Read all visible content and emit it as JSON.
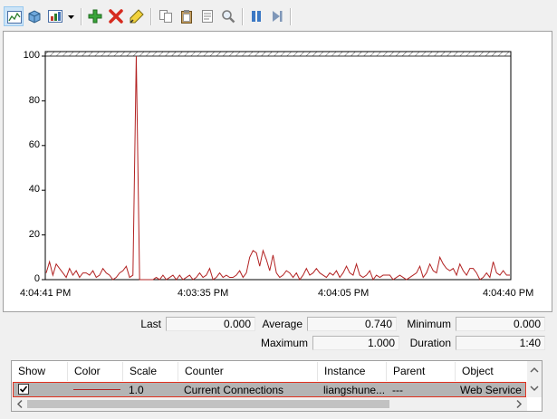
{
  "toolbar": {
    "icons": [
      "change-graph-type-icon",
      "view-current-activity-icon",
      "change-view-icon",
      "dropdown-icon",
      "add-counter-icon",
      "delete-counter-icon",
      "highlight-icon",
      "copy-properties-icon",
      "paste-counter-list-icon",
      "properties-icon",
      "zoom-icon",
      "freeze-display-icon",
      "update-data-icon"
    ]
  },
  "chart_data": {
    "type": "line",
    "ylim": [
      0,
      100
    ],
    "yticks": [
      "100",
      "80",
      "60",
      "40",
      "20",
      "0"
    ],
    "xtick_labels": [
      "4:04:41 PM",
      "4:03:35 PM",
      "4:04:05 PM",
      "4:04:40 PM"
    ],
    "grid": false,
    "series": [
      {
        "color": "#b22222",
        "y": [
          3,
          8,
          2,
          7,
          5,
          3,
          1,
          5,
          2,
          4,
          1,
          3,
          3,
          2,
          4,
          1,
          2,
          5,
          3,
          2,
          0,
          1,
          3,
          4,
          6,
          1,
          2,
          100,
          0,
          0,
          0,
          0,
          0,
          1,
          0,
          2,
          0,
          1,
          2,
          0,
          2,
          0,
          1,
          2,
          0,
          1,
          3,
          1,
          2,
          5,
          0,
          1,
          3,
          1,
          2,
          1,
          1,
          2,
          4,
          1,
          3,
          10,
          13,
          12,
          6,
          13,
          9,
          4,
          11,
          3,
          1,
          2,
          4,
          3,
          1,
          3,
          0,
          2,
          5,
          2,
          3,
          5,
          3,
          2,
          1,
          3,
          2,
          4,
          1,
          3,
          6,
          3,
          2,
          7,
          2,
          1,
          2,
          4,
          0,
          2,
          1,
          2,
          2,
          2,
          0,
          1,
          2,
          1,
          0,
          1,
          2,
          3,
          6,
          1,
          3,
          7,
          4,
          3,
          10,
          7,
          5,
          4,
          5,
          2,
          7,
          4,
          2,
          5,
          5,
          3,
          0,
          1,
          3,
          1,
          8,
          3,
          2,
          4,
          2,
          2
        ]
      }
    ]
  },
  "stats": {
    "last_label": "Last",
    "last_value": "0.000",
    "average_label": "Average",
    "average_value": "0.740",
    "minimum_label": "Minimum",
    "minimum_value": "0.000",
    "maximum_label": "Maximum",
    "maximum_value": "1.000",
    "duration_label": "Duration",
    "duration_value": "1:40"
  },
  "list": {
    "headers": [
      "Show",
      "Color",
      "Scale",
      "Counter",
      "Instance",
      "Parent",
      "Object"
    ],
    "rows": [
      {
        "show": true,
        "color": "#b22222",
        "scale": "1.0",
        "counter": "Current Connections",
        "instance": "liangshune...",
        "parent": "---",
        "object": "Web Service"
      }
    ]
  }
}
